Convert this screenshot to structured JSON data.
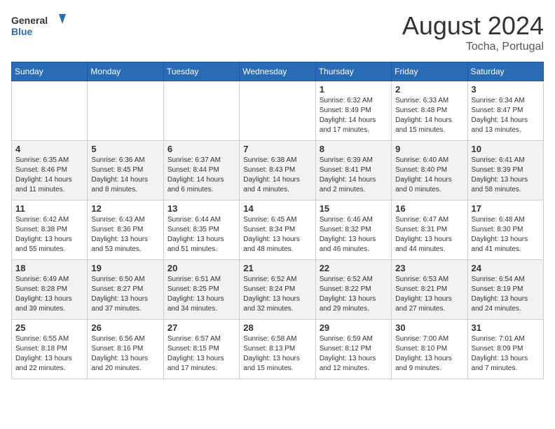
{
  "header": {
    "logo_line1": "General",
    "logo_line2": "Blue",
    "main_title": "August 2024",
    "subtitle": "Tocha, Portugal"
  },
  "weekdays": [
    "Sunday",
    "Monday",
    "Tuesday",
    "Wednesday",
    "Thursday",
    "Friday",
    "Saturday"
  ],
  "weeks": [
    [
      {
        "day": "",
        "info": ""
      },
      {
        "day": "",
        "info": ""
      },
      {
        "day": "",
        "info": ""
      },
      {
        "day": "",
        "info": ""
      },
      {
        "day": "1",
        "info": "Sunrise: 6:32 AM\nSunset: 8:49 PM\nDaylight: 14 hours\nand 17 minutes."
      },
      {
        "day": "2",
        "info": "Sunrise: 6:33 AM\nSunset: 8:48 PM\nDaylight: 14 hours\nand 15 minutes."
      },
      {
        "day": "3",
        "info": "Sunrise: 6:34 AM\nSunset: 8:47 PM\nDaylight: 14 hours\nand 13 minutes."
      }
    ],
    [
      {
        "day": "4",
        "info": "Sunrise: 6:35 AM\nSunset: 8:46 PM\nDaylight: 14 hours\nand 11 minutes."
      },
      {
        "day": "5",
        "info": "Sunrise: 6:36 AM\nSunset: 8:45 PM\nDaylight: 14 hours\nand 8 minutes."
      },
      {
        "day": "6",
        "info": "Sunrise: 6:37 AM\nSunset: 8:44 PM\nDaylight: 14 hours\nand 6 minutes."
      },
      {
        "day": "7",
        "info": "Sunrise: 6:38 AM\nSunset: 8:43 PM\nDaylight: 14 hours\nand 4 minutes."
      },
      {
        "day": "8",
        "info": "Sunrise: 6:39 AM\nSunset: 8:41 PM\nDaylight: 14 hours\nand 2 minutes."
      },
      {
        "day": "9",
        "info": "Sunrise: 6:40 AM\nSunset: 8:40 PM\nDaylight: 14 hours\nand 0 minutes."
      },
      {
        "day": "10",
        "info": "Sunrise: 6:41 AM\nSunset: 8:39 PM\nDaylight: 13 hours\nand 58 minutes."
      }
    ],
    [
      {
        "day": "11",
        "info": "Sunrise: 6:42 AM\nSunset: 8:38 PM\nDaylight: 13 hours\nand 55 minutes."
      },
      {
        "day": "12",
        "info": "Sunrise: 6:43 AM\nSunset: 8:36 PM\nDaylight: 13 hours\nand 53 minutes."
      },
      {
        "day": "13",
        "info": "Sunrise: 6:44 AM\nSunset: 8:35 PM\nDaylight: 13 hours\nand 51 minutes."
      },
      {
        "day": "14",
        "info": "Sunrise: 6:45 AM\nSunset: 8:34 PM\nDaylight: 13 hours\nand 48 minutes."
      },
      {
        "day": "15",
        "info": "Sunrise: 6:46 AM\nSunset: 8:32 PM\nDaylight: 13 hours\nand 46 minutes."
      },
      {
        "day": "16",
        "info": "Sunrise: 6:47 AM\nSunset: 8:31 PM\nDaylight: 13 hours\nand 44 minutes."
      },
      {
        "day": "17",
        "info": "Sunrise: 6:48 AM\nSunset: 8:30 PM\nDaylight: 13 hours\nand 41 minutes."
      }
    ],
    [
      {
        "day": "18",
        "info": "Sunrise: 6:49 AM\nSunset: 8:28 PM\nDaylight: 13 hours\nand 39 minutes."
      },
      {
        "day": "19",
        "info": "Sunrise: 6:50 AM\nSunset: 8:27 PM\nDaylight: 13 hours\nand 37 minutes."
      },
      {
        "day": "20",
        "info": "Sunrise: 6:51 AM\nSunset: 8:25 PM\nDaylight: 13 hours\nand 34 minutes."
      },
      {
        "day": "21",
        "info": "Sunrise: 6:52 AM\nSunset: 8:24 PM\nDaylight: 13 hours\nand 32 minutes."
      },
      {
        "day": "22",
        "info": "Sunrise: 6:52 AM\nSunset: 8:22 PM\nDaylight: 13 hours\nand 29 minutes."
      },
      {
        "day": "23",
        "info": "Sunrise: 6:53 AM\nSunset: 8:21 PM\nDaylight: 13 hours\nand 27 minutes."
      },
      {
        "day": "24",
        "info": "Sunrise: 6:54 AM\nSunset: 8:19 PM\nDaylight: 13 hours\nand 24 minutes."
      }
    ],
    [
      {
        "day": "25",
        "info": "Sunrise: 6:55 AM\nSunset: 8:18 PM\nDaylight: 13 hours\nand 22 minutes."
      },
      {
        "day": "26",
        "info": "Sunrise: 6:56 AM\nSunset: 8:16 PM\nDaylight: 13 hours\nand 20 minutes."
      },
      {
        "day": "27",
        "info": "Sunrise: 6:57 AM\nSunset: 8:15 PM\nDaylight: 13 hours\nand 17 minutes."
      },
      {
        "day": "28",
        "info": "Sunrise: 6:58 AM\nSunset: 8:13 PM\nDaylight: 13 hours\nand 15 minutes."
      },
      {
        "day": "29",
        "info": "Sunrise: 6:59 AM\nSunset: 8:12 PM\nDaylight: 13 hours\nand 12 minutes."
      },
      {
        "day": "30",
        "info": "Sunrise: 7:00 AM\nSunset: 8:10 PM\nDaylight: 13 hours\nand 9 minutes."
      },
      {
        "day": "31",
        "info": "Sunrise: 7:01 AM\nSunset: 8:09 PM\nDaylight: 13 hours\nand 7 minutes."
      }
    ]
  ]
}
